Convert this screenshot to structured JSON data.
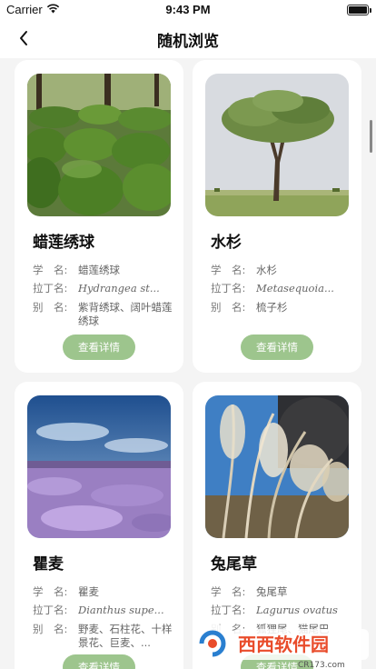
{
  "status_bar": {
    "carrier": "Carrier",
    "time": "9:43 PM"
  },
  "nav": {
    "title": "随机浏览"
  },
  "labels": {
    "sci_name": "学　名:",
    "latin": "拉丁名:",
    "alias": "别　名:",
    "detail": "查看详情"
  },
  "plants": [
    {
      "name": "蜡莲绣球",
      "sci": "蜡莲绣球",
      "latin": "Hydrangea st...",
      "alias": "紫背绣球、阔叶蜡莲绣球"
    },
    {
      "name": "水杉",
      "sci": "水杉",
      "latin": "Metasequoia...",
      "alias": "梳子杉"
    },
    {
      "name": "瞿麦",
      "sci": "瞿麦",
      "latin": "Dianthus supe...",
      "alias": "野麦、石柱花、十样景花、巨麦、..."
    },
    {
      "name": "兔尾草",
      "sci": "兔尾草",
      "latin": "Lagurus ovatus",
      "alias": "狐狸尾、猫尾巴"
    }
  ],
  "watermark": {
    "text": "西西软件园",
    "url": "CR173.com"
  },
  "colors": {
    "accent": "#9dc58d",
    "background": "#f4f4f4"
  },
  "icons": {
    "back": "chevron-left-icon",
    "wifi": "wifi-icon",
    "battery": "battery-icon"
  }
}
